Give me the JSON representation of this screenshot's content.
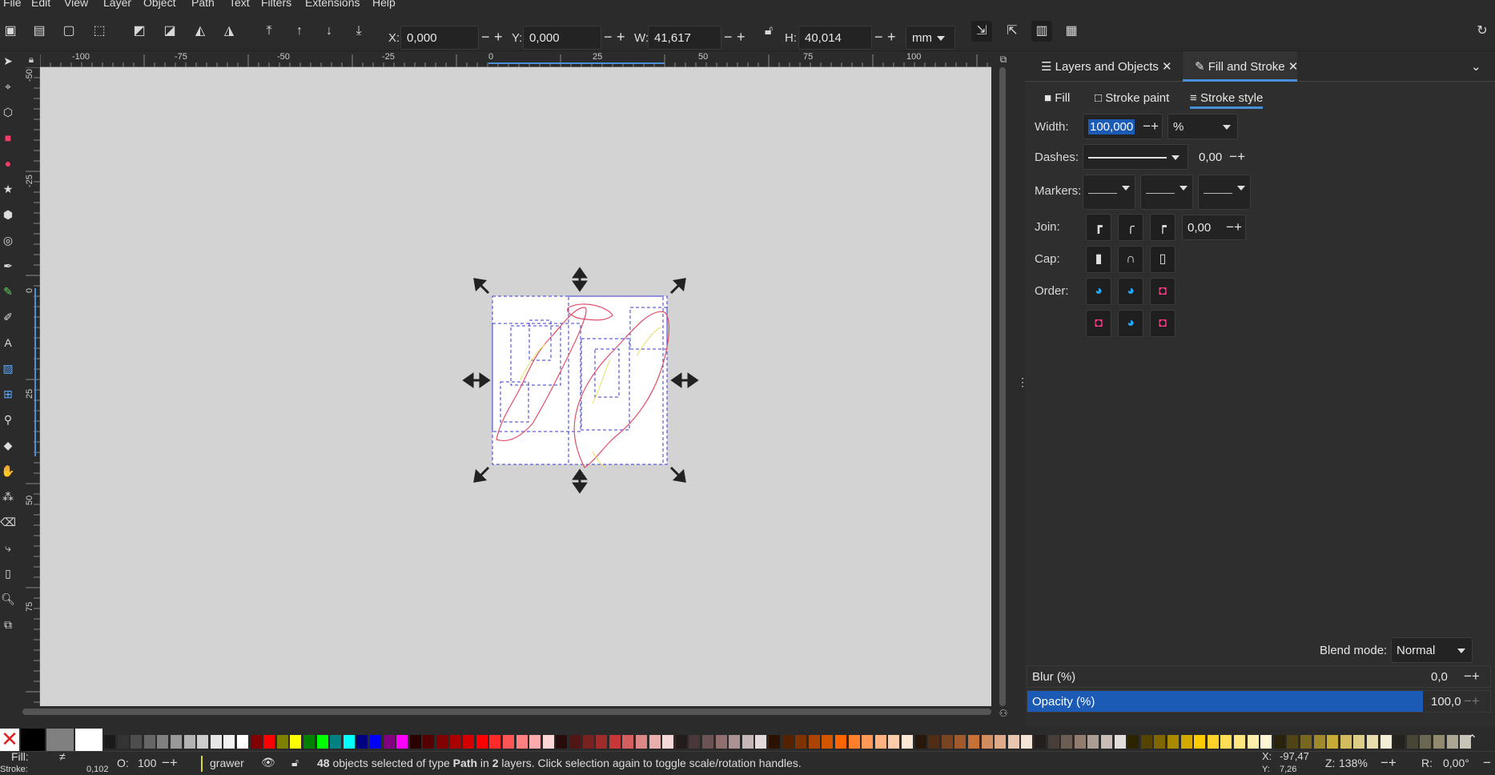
{
  "menubar": {
    "items": [
      "File",
      "Edit",
      "View",
      "Layer",
      "Object",
      "Path",
      "Text",
      "Filters",
      "Extensions",
      "Help"
    ]
  },
  "toolbar": {
    "x_label": "X:",
    "x_value": "0,000",
    "y_label": "Y:",
    "y_value": "0,000",
    "w_label": "W:",
    "w_value": "41,617",
    "h_label": "H:",
    "h_value": "40,014",
    "unit": "mm"
  },
  "ruler": {
    "h_ticks": [
      "-100",
      "-75",
      "-50",
      "-25",
      "0",
      "25",
      "50",
      "75",
      "100"
    ],
    "v_ticks": [
      "-50",
      "-25",
      "0",
      "25",
      "50",
      "75"
    ]
  },
  "panel": {
    "tabs": [
      "Layers and Objects",
      "Fill and Stroke"
    ],
    "active_tab": "Fill and Stroke",
    "subtabs": [
      "Fill",
      "Stroke paint",
      "Stroke style"
    ],
    "active_subtab": "Stroke style",
    "width_label": "Width:",
    "width_value": "100,000",
    "width_unit": "%",
    "dashes_label": "Dashes:",
    "dash_offset": "0,00",
    "markers_label": "Markers:",
    "join_label": "Join:",
    "miter_value": "0,00",
    "cap_label": "Cap:",
    "order_label": "Order:",
    "blend_label": "Blend mode:",
    "blend_value": "Normal",
    "blur_label": "Blur (%)",
    "blur_value": "0,0",
    "opacity_label": "Opacity (%)",
    "opacity_value": "100,0"
  },
  "status": {
    "fill_label": "Fill:",
    "fill_value": "≠",
    "stroke_label": "Stroke:",
    "stroke_value": "0,102",
    "opacity_label": "O:",
    "opacity_value": "100",
    "layer": "grawer",
    "message_count": "48",
    "message_pre": " objects selected of type ",
    "message_type": "Path",
    "message_mid": " in ",
    "message_layers": "2",
    "message_post": " layers. Click selection again to toggle scale/rotation handles.",
    "cursor_x_label": "X:",
    "cursor_x": "-97,47",
    "cursor_y_label": "Y:",
    "cursor_y": "7,26",
    "zoom_label": "Z:",
    "zoom": "138%",
    "rotation_label": "R:",
    "rotation": "0,00°"
  },
  "colors": {
    "accent": "#4a90d9",
    "selection": "#1b5bb5",
    "canvas": "#d3d3d3",
    "path_red": "#e0506a",
    "path_yellow": "#e8e060",
    "bbox_blue": "#3a3ad0"
  }
}
